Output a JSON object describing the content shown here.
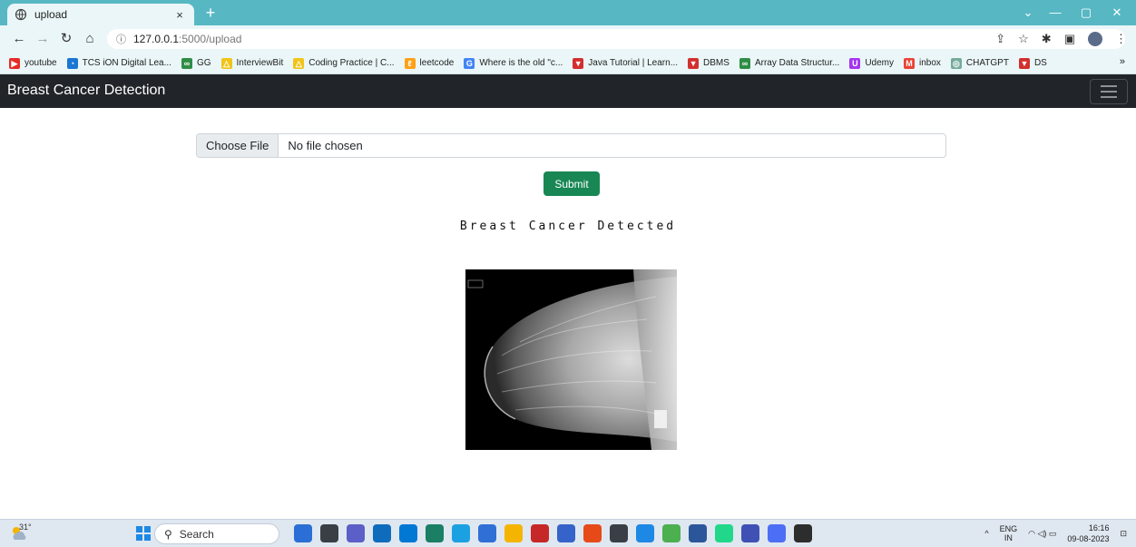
{
  "browser": {
    "tab": {
      "title": "upload",
      "close": "×"
    },
    "new_tab": "+",
    "window_controls": {
      "minimize": "—",
      "maximize": "▢",
      "close": "✕",
      "tablist": "⌄"
    },
    "address": {
      "info_glyph": "ⓘ",
      "host": "127.0.0.1",
      "path": ":5000/upload"
    },
    "bookmarks": [
      {
        "label": "youtube",
        "icon": "youtube-icon",
        "color": "#e52d27",
        "glyph": "▶"
      },
      {
        "label": "TCS iON Digital Lea...",
        "icon": "tcs-icon",
        "color": "#1976d2",
        "glyph": "◔"
      },
      {
        "label": "GG",
        "icon": "gfg-icon",
        "color": "#2f8d46",
        "glyph": "∞"
      },
      {
        "label": "InterviewBit",
        "icon": "interviewbit-icon",
        "color": "#f0c419",
        "glyph": "△"
      },
      {
        "label": "Coding Practice | C...",
        "icon": "coding-icon",
        "color": "#f0c419",
        "glyph": "△"
      },
      {
        "label": "leetcode",
        "icon": "leetcode-icon",
        "color": "#ffa116",
        "glyph": "ℓ"
      },
      {
        "label": "Where is the old \"c...",
        "icon": "google-icon",
        "color": "#4285f4",
        "glyph": "G"
      },
      {
        "label": "Java Tutorial | Learn...",
        "icon": "javatpoint-icon",
        "color": "#d32f2f",
        "glyph": "▼"
      },
      {
        "label": "DBMS",
        "icon": "dbms-icon",
        "color": "#d32f2f",
        "glyph": "▼"
      },
      {
        "label": "Array Data Structur...",
        "icon": "gfg-icon",
        "color": "#2f8d46",
        "glyph": "∞"
      },
      {
        "label": "Udemy",
        "icon": "udemy-icon",
        "color": "#a435f0",
        "glyph": "U"
      },
      {
        "label": "inbox",
        "icon": "gmail-icon",
        "color": "#ea4335",
        "glyph": "M"
      },
      {
        "label": "CHATGPT",
        "icon": "chatgpt-icon",
        "color": "#74aa9c",
        "glyph": "◎"
      },
      {
        "label": "DS",
        "icon": "ds-icon",
        "color": "#d32f2f",
        "glyph": "▼"
      }
    ],
    "bookmarks_more": "»"
  },
  "app": {
    "brand": "Breast Cancer Detection",
    "file_button": "Choose File",
    "file_status": "No file chosen",
    "submit_label": "Submit",
    "result_text": "Breast Cancer Detected"
  },
  "taskbar": {
    "weather": "31°",
    "search_placeholder": "Search",
    "apps": [
      {
        "icon": "bing-icon",
        "color": "#2b6fd6"
      },
      {
        "icon": "task-view-icon",
        "color": "#3a3f46"
      },
      {
        "icon": "teams-icon",
        "color": "#5b5fc7"
      },
      {
        "icon": "store-icon",
        "color": "#0f6cbd"
      },
      {
        "icon": "mail-icon",
        "color": "#0078d4"
      },
      {
        "icon": "l-app-icon",
        "color": "#1a7f64"
      },
      {
        "icon": "edge-icon",
        "color": "#1ba1e2"
      },
      {
        "icon": "chat-icon",
        "color": "#2f6fd6"
      },
      {
        "icon": "file-explorer-icon",
        "color": "#f4b400"
      },
      {
        "icon": "mcafee-icon",
        "color": "#c62828"
      },
      {
        "icon": "photos-icon",
        "color": "#3563c9"
      },
      {
        "icon": "office-icon",
        "color": "#e64a19"
      },
      {
        "icon": "virtualbox-icon",
        "color": "#3a3f46"
      },
      {
        "icon": "vscode-icon",
        "color": "#1e88e5"
      },
      {
        "icon": "chrome-icon",
        "color": "#4caf50"
      },
      {
        "icon": "word-icon",
        "color": "#2b579a"
      },
      {
        "icon": "pycharm-icon",
        "color": "#21d789"
      },
      {
        "icon": "network-app-icon",
        "color": "#3f51b5"
      },
      {
        "icon": "notepad-icon",
        "color": "#4c6ef5"
      },
      {
        "icon": "terminal-icon",
        "color": "#2d2d2d"
      }
    ],
    "tray_chevron": "^",
    "lang_top": "ENG",
    "lang_bottom": "IN",
    "status_icons": "◠ ◁) ▭",
    "time": "16:16",
    "date": "09-08-2023",
    "notify": "⊡"
  }
}
